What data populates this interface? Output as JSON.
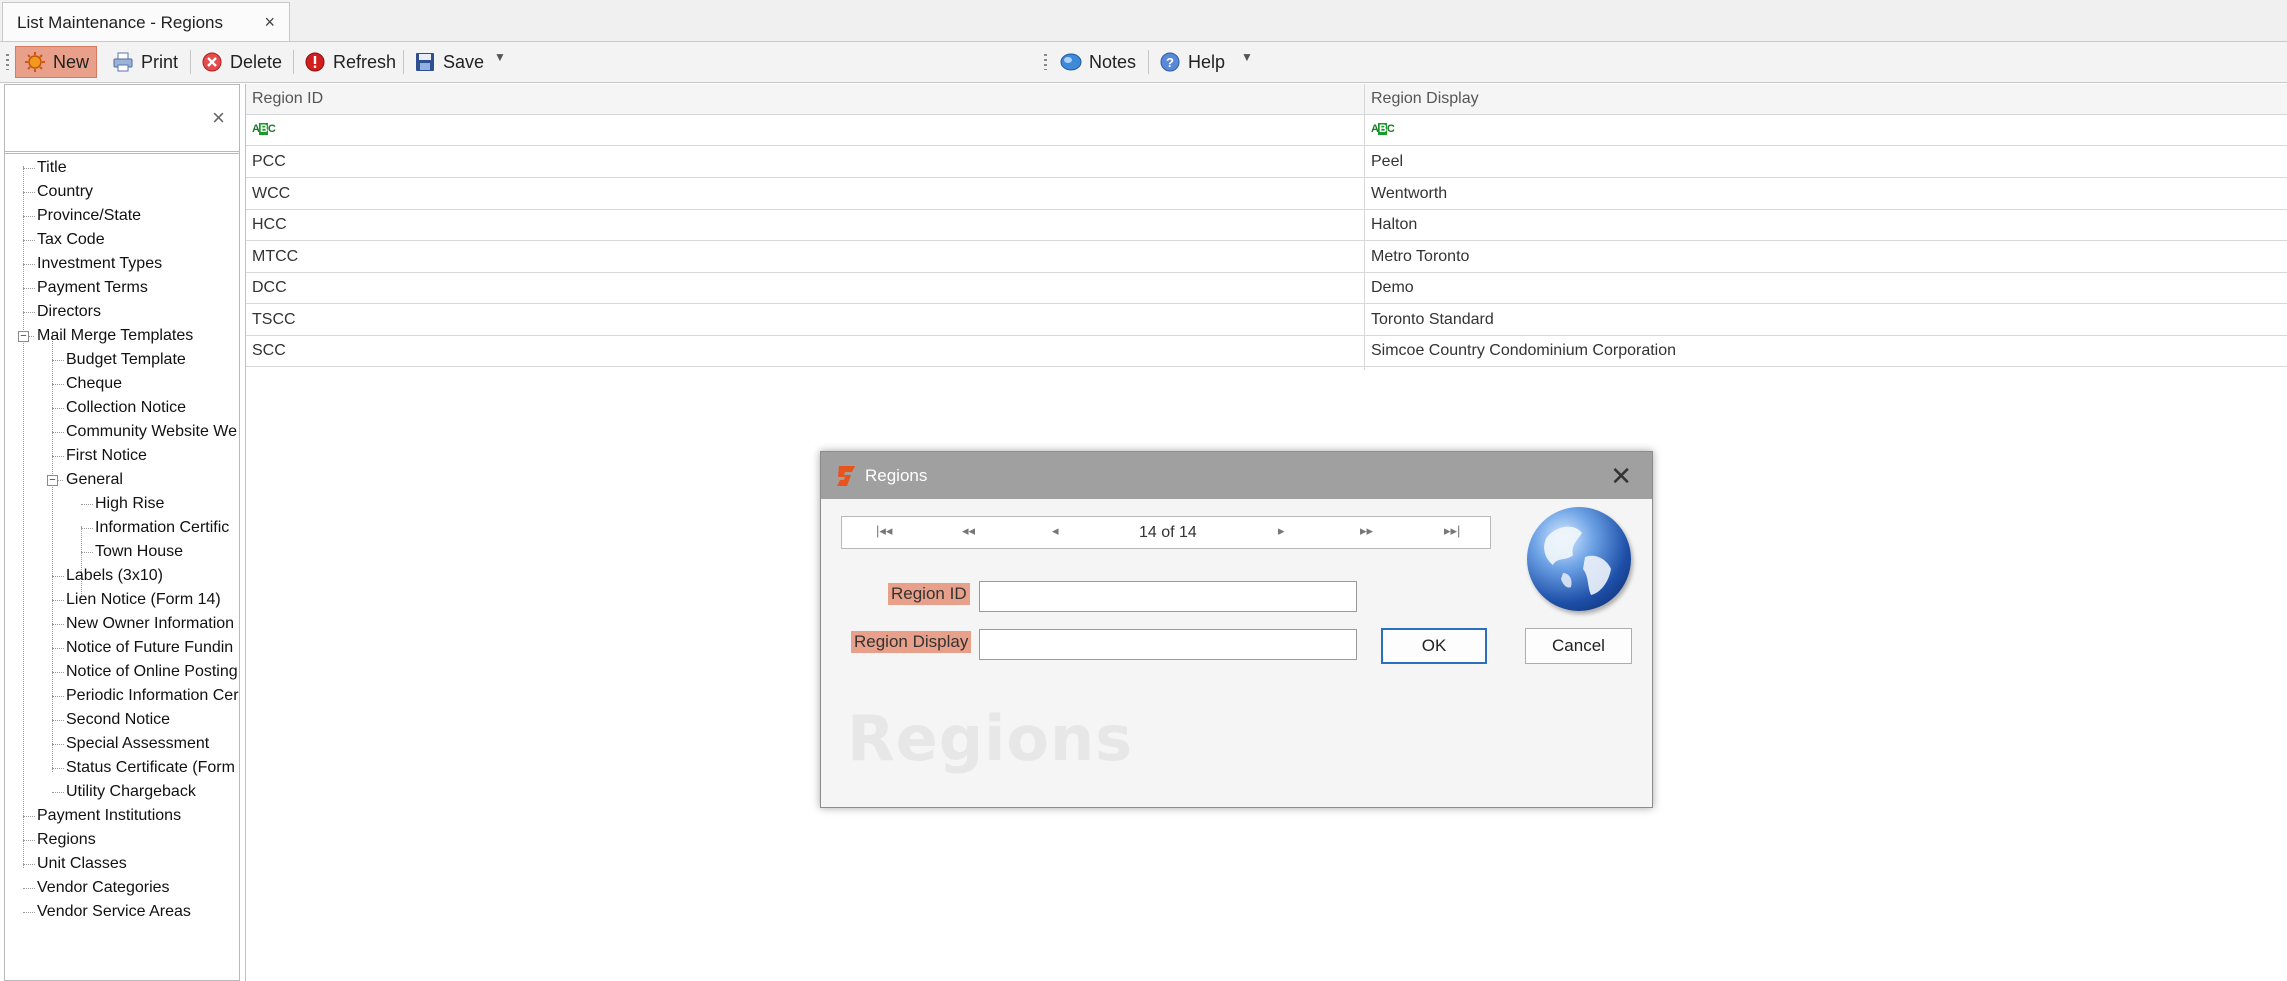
{
  "tab": {
    "title": "List Maintenance - Regions",
    "close": "×"
  },
  "toolbar": {
    "new": "New",
    "print": "Print",
    "delete": "Delete",
    "refresh": "Refresh",
    "save": "Save",
    "notes": "Notes",
    "help": "Help"
  },
  "left_panel": {
    "close": "×"
  },
  "tree": [
    "Title",
    "Country",
    "Province/State",
    "Tax Code",
    "Investment Types",
    "Payment Terms",
    "Directors",
    "Mail Merge Templates",
    "Budget Template",
    "Cheque",
    "Collection Notice",
    "Community Website We",
    "First Notice",
    "General",
    "High Rise",
    "Information Certific",
    "Town House",
    "Labels (3x10)",
    "Lien Notice (Form 14)",
    "New Owner Information",
    "Notice of Future Fundin",
    "Notice of Online Posting",
    "Periodic Information Cer",
    "Second Notice",
    "Special Assessment",
    "Status Certificate (Form",
    "Utility Chargeback",
    "Payment Institutions",
    "Regions",
    "Unit Classes",
    "Vendor Categories",
    "Vendor Service Areas"
  ],
  "grid": {
    "columns": [
      "Region ID",
      "Region Display"
    ],
    "rows": [
      [
        "PCC",
        "Peel"
      ],
      [
        "WCC",
        "Wentworth"
      ],
      [
        "HCC",
        "Halton"
      ],
      [
        "MTCC",
        "Metro Toronto"
      ],
      [
        "DCC",
        "Demo"
      ],
      [
        "TSCC",
        "Toronto Standard"
      ],
      [
        "SCC",
        "Simcoe Country Condominium Corporation"
      ]
    ]
  },
  "dialog": {
    "title": "Regions",
    "close": "✕",
    "nav_position": "14 of 14",
    "region_id_label": "Region ID",
    "region_display_label": "Region Display",
    "region_id_value": "",
    "region_display_value": "",
    "ok": "OK",
    "cancel": "Cancel",
    "watermark": "Regions"
  }
}
